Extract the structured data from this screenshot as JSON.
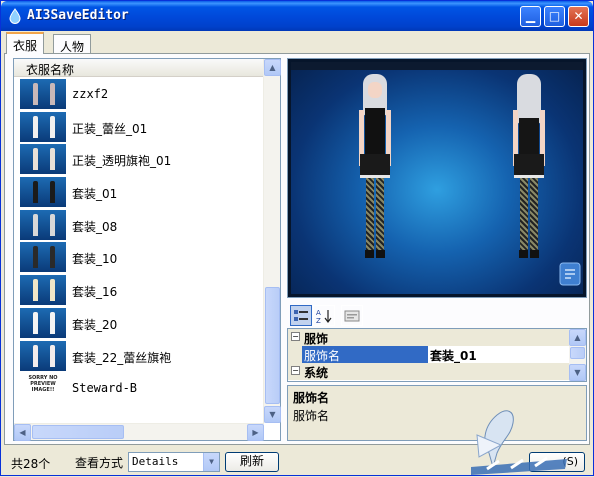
{
  "window": {
    "title": "AI3SaveEditor"
  },
  "title_buttons": {
    "minimize_icon": "minimize-icon",
    "maximize_icon": "maximize-icon",
    "close_icon": "close-icon"
  },
  "tabs": [
    {
      "label": "衣服",
      "active": true
    },
    {
      "label": "人物",
      "active": false
    }
  ],
  "list": {
    "header": "衣服名称",
    "items": [
      {
        "label": "zzxf2",
        "mono": true
      },
      {
        "label": "正装_蕾丝_01"
      },
      {
        "label": "正装_透明旗袍_01"
      },
      {
        "label": "套装_01"
      },
      {
        "label": "套装_08"
      },
      {
        "label": "套装_10"
      },
      {
        "label": "套装_16"
      },
      {
        "label": "套装_20"
      },
      {
        "label": "套装_22_蕾丝旗袍"
      },
      {
        "label": "Steward-B",
        "mono": true,
        "logo_text": "SORRY NO PREVIEW IMAGE!!"
      }
    ]
  },
  "property_grid": {
    "categories": [
      {
        "label": "服饰",
        "expanded": true,
        "props": [
          {
            "name": "服饰名",
            "value": "套装_01"
          }
        ]
      },
      {
        "label": "系统",
        "expanded": true,
        "props": []
      }
    ],
    "description": {
      "title": "服饰名",
      "text": "服饰名"
    },
    "toolbar_icons": [
      "categorized-icon",
      "alphabetical-sort-icon",
      "property-pages-icon"
    ]
  },
  "bottom": {
    "count": "共28个",
    "view_label": "查看方式",
    "view_value": "Details",
    "refresh_label": "刷新",
    "partial_button": "(S)"
  },
  "colors": {
    "title_bar": "#0055e5",
    "selection": "#316ac5",
    "stage": "#1563b0"
  }
}
